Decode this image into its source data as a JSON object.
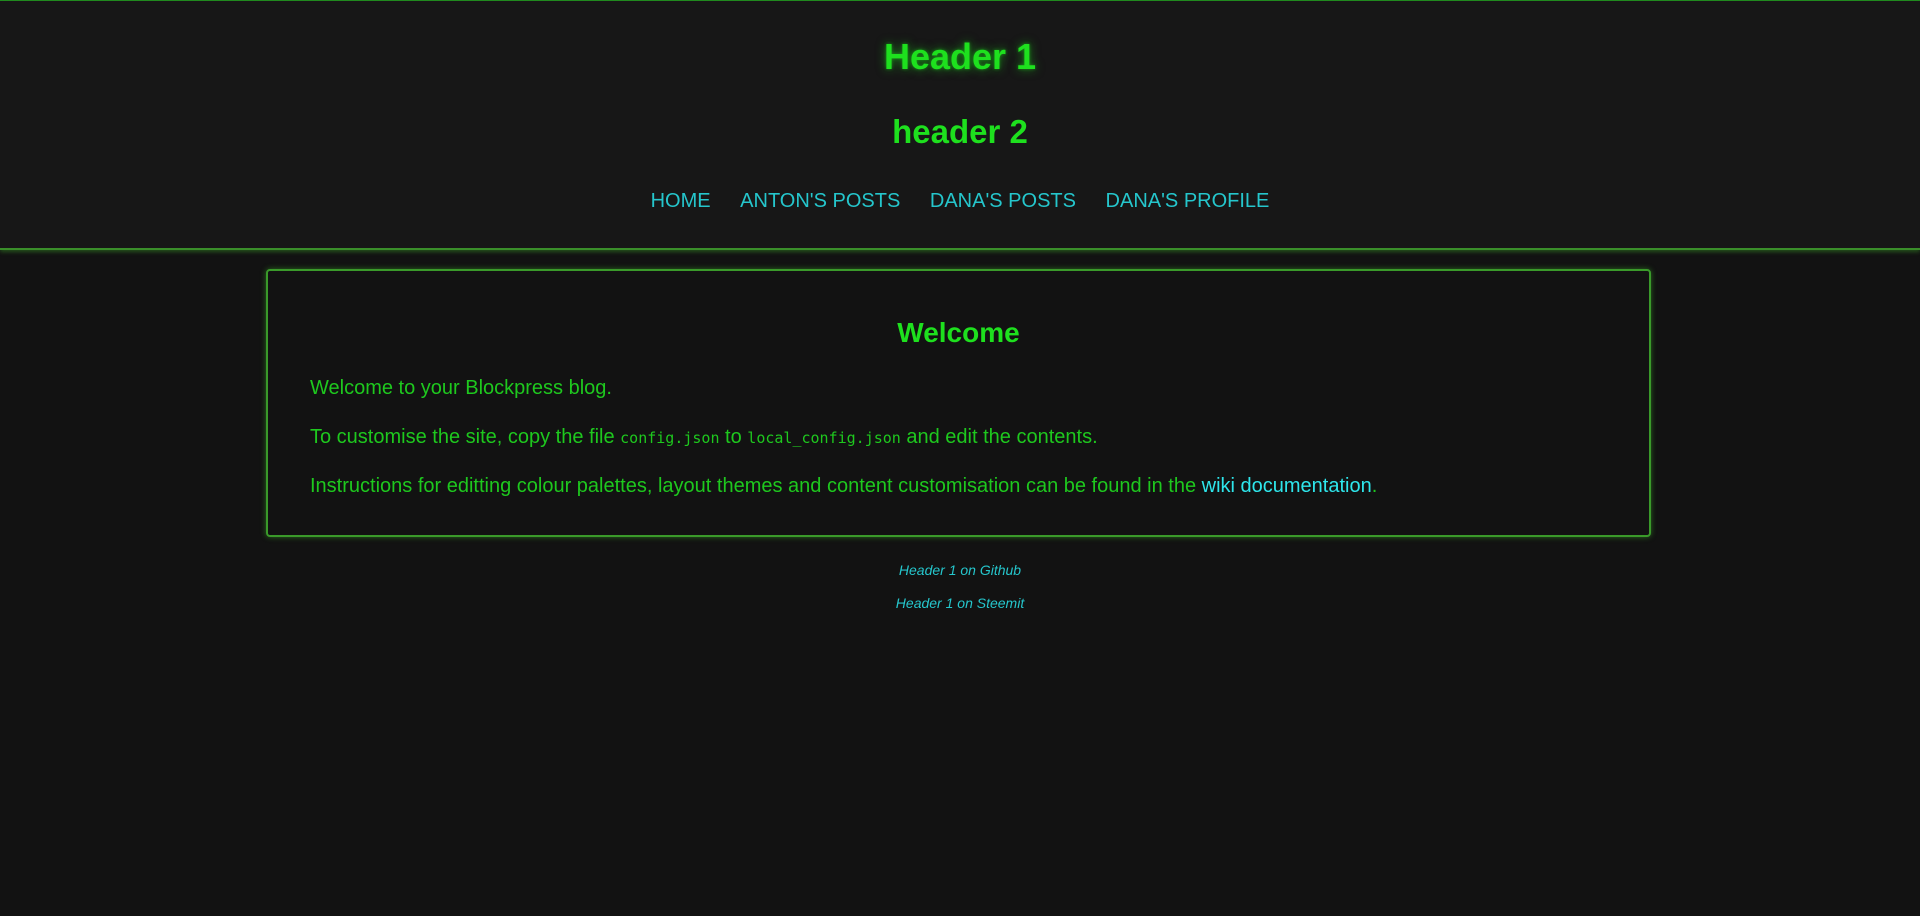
{
  "header": {
    "title": "Header 1",
    "subtitle": "header 2"
  },
  "nav": {
    "items": [
      {
        "label": "HOME"
      },
      {
        "label": "ANTON'S POSTS"
      },
      {
        "label": "DANA'S POSTS"
      },
      {
        "label": "DANA'S PROFILE"
      }
    ]
  },
  "card": {
    "title": "Welcome",
    "p1": "Welcome to your Blockpress blog.",
    "p2": {
      "before": "To customise the site, copy the file ",
      "code1": "config.json",
      "middle": " to ",
      "code2": "local_config.json",
      "after": " and edit the contents."
    },
    "p3": {
      "before": "Instructions for editting colour palettes, layout themes and content customisation can be found in the ",
      "link": "wiki documentation",
      "after": "."
    }
  },
  "footer": {
    "links": [
      {
        "label": "Header 1 on Github"
      },
      {
        "label": "Header 1 on Steemit"
      }
    ]
  },
  "colors": {
    "background": "#121212",
    "header_background": "#171717",
    "accent_green": "#1ee01e",
    "link_cyan": "#25c6cc",
    "border_green": "#3a9a2a"
  }
}
